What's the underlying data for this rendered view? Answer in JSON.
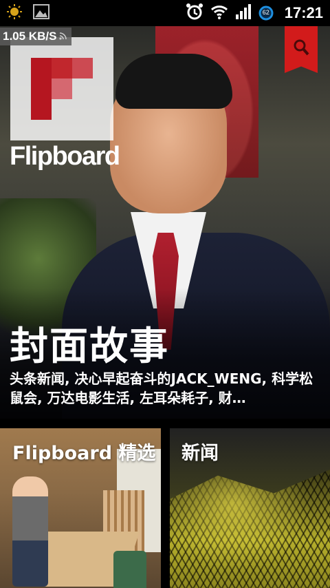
{
  "status_bar": {
    "time": "17:21",
    "battery_level": "62",
    "net_speed": "1.05 KB/S",
    "icons": [
      "notification-sun-icon",
      "gallery-icon",
      "alarm-icon",
      "wifi-icon",
      "signal-icon",
      "battery-icon"
    ]
  },
  "app": {
    "brand": "Flipboard",
    "accent_color": "#d21b1b"
  },
  "cover": {
    "title": "封面故事",
    "subtitle": "头条新闻, 决心早起奋斗的JACK_WENG, 科学松鼠会, 万达电影生活, 左耳朵耗子, 财…"
  },
  "tiles": [
    {
      "label": "Flipboard 精选"
    },
    {
      "label": "新闻"
    }
  ]
}
